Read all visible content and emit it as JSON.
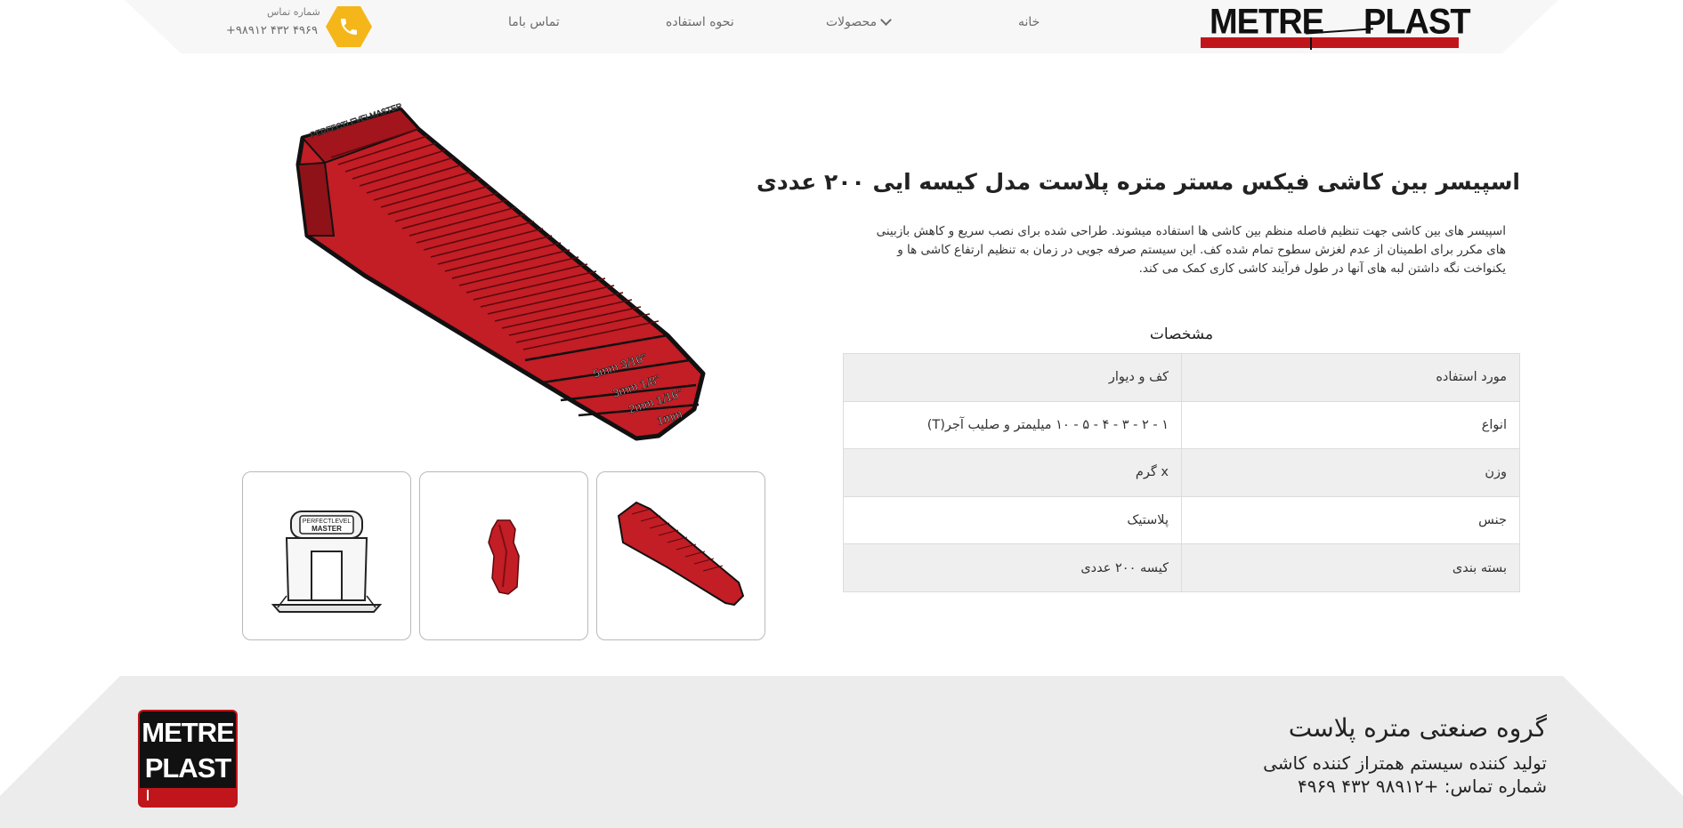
{
  "header": {
    "logo": {
      "word1": "METRE",
      "word2": "PLAST"
    },
    "nav": {
      "home": "خانه",
      "products": "محصولات",
      "how_to_use": "نحوه استفاده",
      "contact": "تماس باما"
    },
    "phone_label": "شماره تماس",
    "phone_number": "+۹۸۹۱۲ ۴۳۲ ۴۹۶۹",
    "accent_color": "#f5b61a",
    "brand_red": "#c0161b"
  },
  "product": {
    "title": "اسپیسر بین کاشی فیکس مستر متره پلاست مدل کیسه ایی ۲۰۰ عددی",
    "description": "اسپیسر های بین کاشی جهت تنظیم فاصله منظم بین کاشی ها استفاده میشوند. طراحی شده برای نصب سریع و کاهش بازبینی های مکرر برای اطمینان از عدم لغزش سطوح تمام شده کف. این سیستم صرفه جویی در زمان به تنظیم ارتفاع کاشی ها و یکنواخت نگه داشتن لبه های آنها در طول فرآیند کاشی کاری کمک می کند.",
    "main_image_labels": [
      "PERFECTLEVELMASTER",
      "5mm  3/16\"",
      "3mm  1/8\"",
      "2mm  1/16\"",
      "1mm"
    ],
    "thumbnail_label": [
      "PERFECTLEVEL",
      "MASTER"
    ],
    "specs_title": "مشخصات",
    "specs": [
      {
        "key": "مورد استفاده",
        "value": "کف و دیوار"
      },
      {
        "key": "انواع",
        "value": "۱ - ۲ - ۳ - ۴ - ۵ - ۱۰ میلیمتر و صلیب آجر(T)"
      },
      {
        "key": "وزن",
        "value": "x گرم"
      },
      {
        "key": "جنس",
        "value": "پلاستیک"
      },
      {
        "key": "بسته بندی",
        "value": "کیسه ۲۰۰ عددی"
      }
    ]
  },
  "footer": {
    "logo": {
      "word1": "METRE",
      "word2": "PLAST"
    },
    "company": "گروه صنعتی متره پلاست",
    "subtitle": "تولید کننده سیستم همتراز کننده کاشی",
    "phone_line": "شماره تماس:  +۹۸۹۱۲ ۴۳۲ ۴۹۶۹"
  }
}
